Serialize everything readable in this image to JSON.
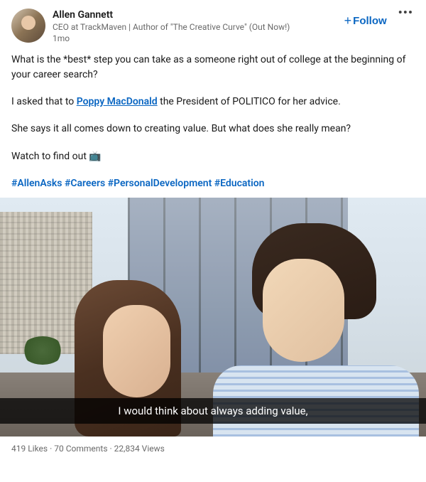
{
  "header": {
    "author_name": "Allen Gannett",
    "author_headline": "CEO at TrackMaven | Author of \"The Creative Curve\" (Out Now!)",
    "time": "1mo",
    "follow_label": "Follow"
  },
  "content": {
    "p1": "What is the *best* step you can take as a someone right out of college at the beginning of your career search?",
    "p2_pre": "I asked that to ",
    "p2_mention": "Poppy MacDonald",
    "p2_post": " the President of POLITICO for her advice.",
    "p3": "She says it all comes down to creating value. But what does she really mean?",
    "p4": "Watch to find out 📺",
    "hashtags": "#AllenAsks #Careers #PersonalDevelopment #Education"
  },
  "video": {
    "caption": "I would think about always adding value,"
  },
  "stats": {
    "likes": "419 Likes",
    "comments": "70 Comments",
    "views": "22,834 Views"
  }
}
